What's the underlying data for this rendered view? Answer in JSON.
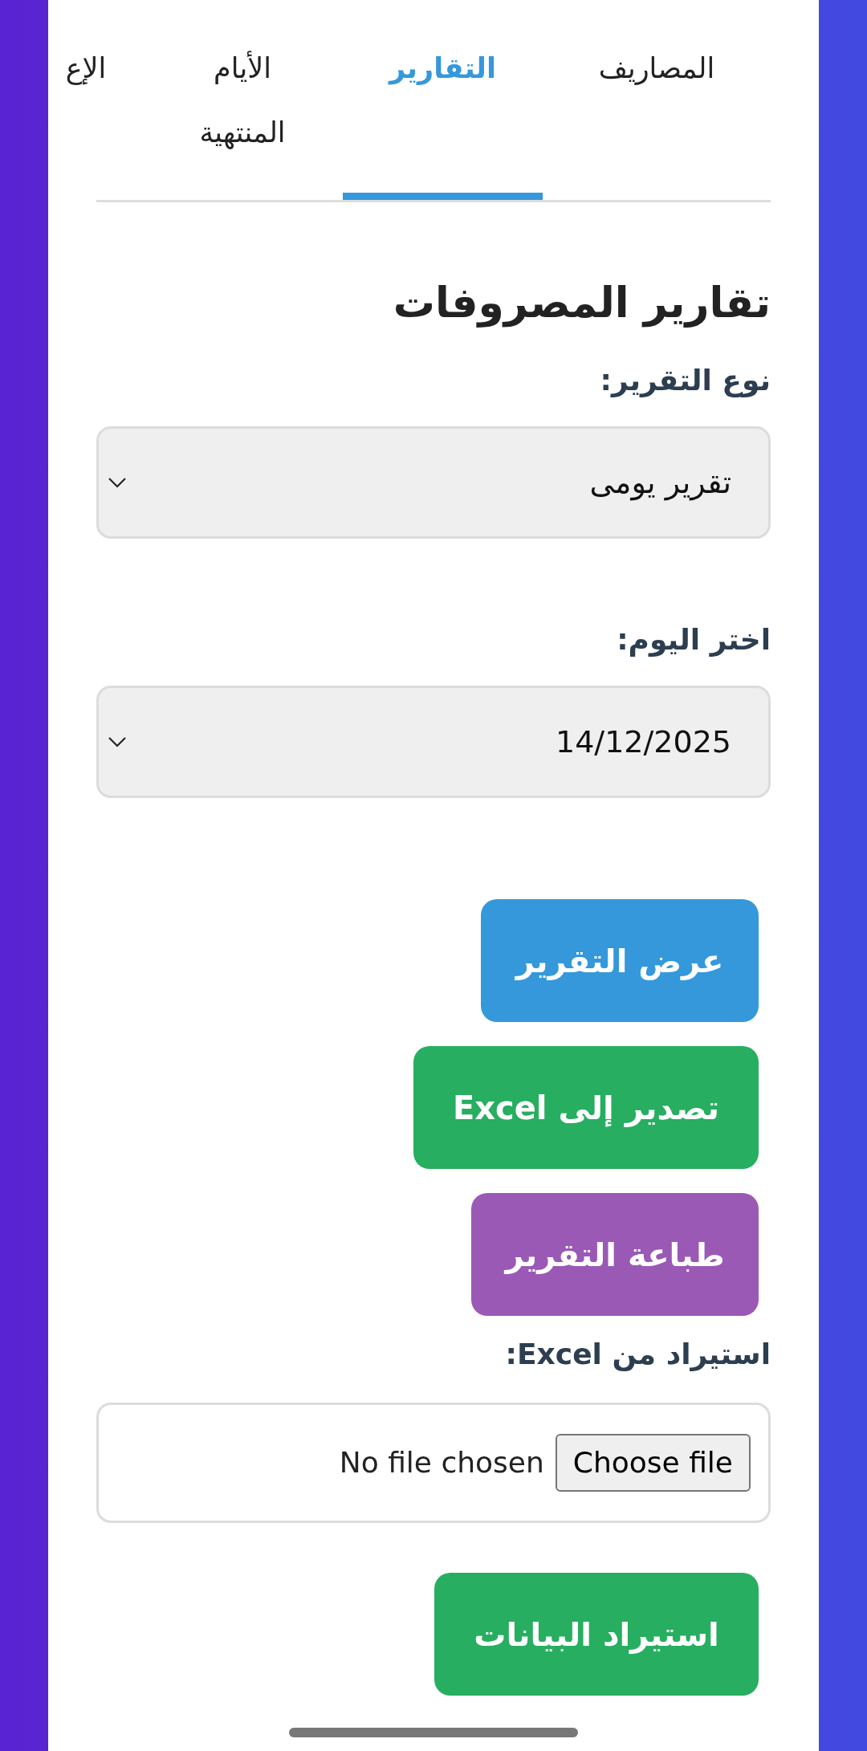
{
  "tabs": [
    {
      "label": "المصاريف",
      "selected": false
    },
    {
      "label": "التقارير",
      "selected": true
    },
    {
      "label": "الأيام المنتهية",
      "selected": false
    },
    {
      "label": "الإع",
      "selected": false
    }
  ],
  "heading": "تقارير المصروفات",
  "report_type": {
    "label": "نوع التقرير:",
    "value": "تقرير يومى"
  },
  "date": {
    "label": "اختر اليوم:",
    "value": "14/12/2025"
  },
  "buttons": [
    {
      "label": "عرض التقرير",
      "color": "#3498db"
    },
    {
      "label": "تصدير إلى Excel",
      "color": "#27ae60"
    },
    {
      "label": "طباعة التقرير",
      "color": "#9b59b6"
    }
  ],
  "import": {
    "label": "استيراد من **Excel**:",
    "file_button": "Choose file",
    "file_status": "No file chosen",
    "button": {
      "label": "استيراد البيانات",
      "color": "#27ae60"
    }
  }
}
